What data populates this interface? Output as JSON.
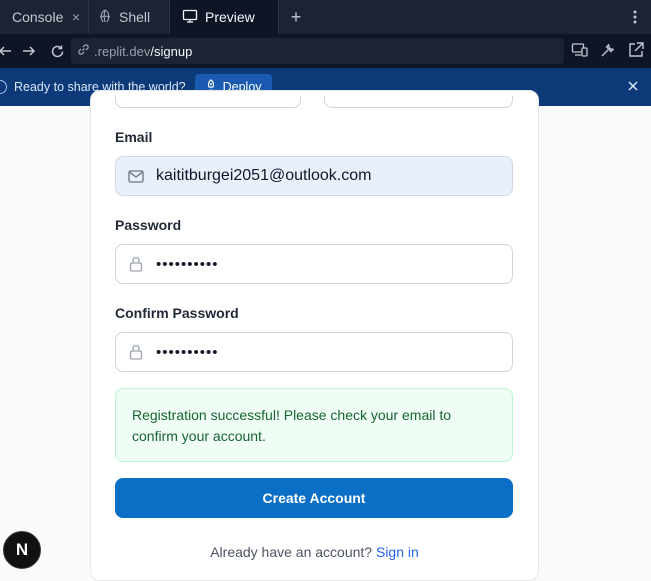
{
  "tabs": {
    "console": "Console",
    "shell": "Shell",
    "preview": "Preview",
    "close_glyph": "×",
    "add_glyph": "+"
  },
  "urlbar": {
    "domain": ".replit.dev",
    "path": "/signup"
  },
  "banner": {
    "text": "Ready to share with the world?",
    "deploy_label": "Deploy"
  },
  "form": {
    "email_label": "Email",
    "email_value": "kaititburgei2051@outlook.com",
    "password_label": "Password",
    "password_value": "••••••••••",
    "confirm_label": "Confirm Password",
    "confirm_value": "••••••••••",
    "success_message": "Registration successful! Please check your email to confirm your account.",
    "submit_label": "Create Account",
    "signin_prompt": "Already have an account?",
    "signin_link": "Sign in"
  },
  "badge": {
    "letter": "N"
  },
  "colors": {
    "primary": "#0b6fc5",
    "banner": "#0c3a78",
    "success_bg": "#f0fdf4",
    "success_text": "#166534",
    "link": "#2563eb"
  }
}
